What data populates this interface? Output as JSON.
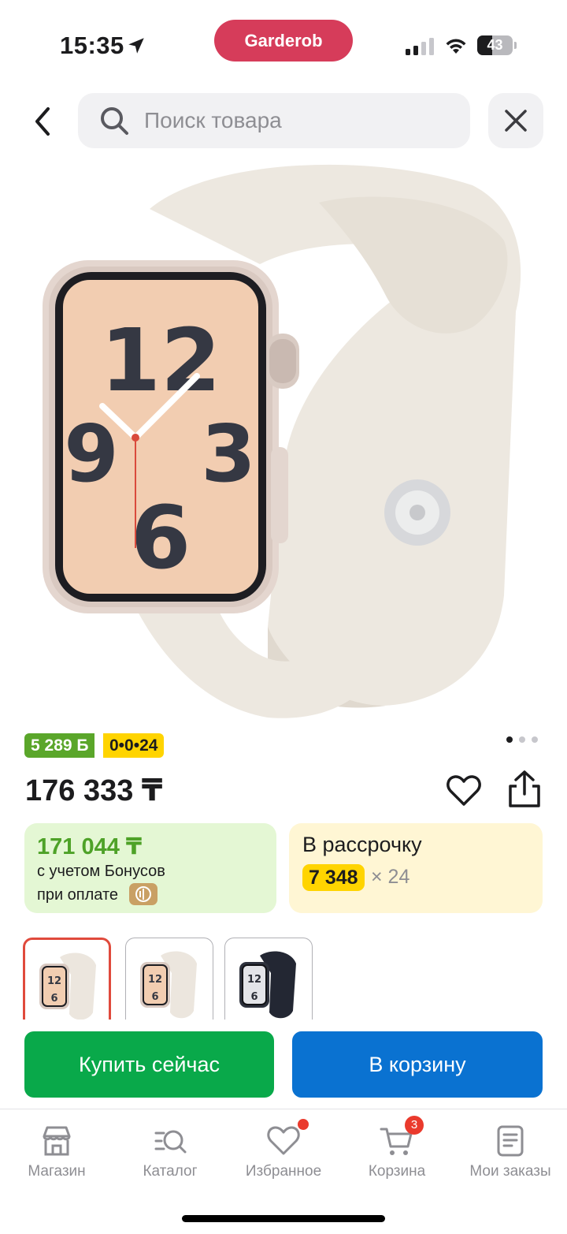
{
  "status_bar": {
    "time": "15:35",
    "app_name": "Garderob",
    "battery": "43",
    "battery_level": 0.43
  },
  "search": {
    "placeholder": "Поиск товара"
  },
  "product": {
    "bonus_badge": "5 289 Б",
    "installment_badge": "0•0•24",
    "price": "176 333 ₸",
    "image_count": 3,
    "active_image": 1
  },
  "bonus_card": {
    "price": "171 044 ₸",
    "line1": "с учетом Бонусов",
    "line2": "при оплате"
  },
  "installment_card": {
    "title": "В рассрочку",
    "amount": "7 348",
    "months": "× 24"
  },
  "thumbnails": [
    {
      "variant": "starlight-gold-face",
      "selected": true
    },
    {
      "variant": "starlight-gold-face",
      "selected": false
    },
    {
      "variant": "midnight",
      "selected": false
    }
  ],
  "actions": {
    "buy_now": "Купить сейчас",
    "add_to_cart": "В корзину"
  },
  "tabs": [
    {
      "label": "Магазин",
      "icon": "store-icon"
    },
    {
      "label": "Каталог",
      "icon": "catalog-search-icon"
    },
    {
      "label": "Избранное",
      "icon": "heart-icon"
    },
    {
      "label": "Корзина",
      "icon": "cart-icon",
      "badge": "3"
    },
    {
      "label": "Мои заказы",
      "icon": "orders-icon"
    }
  ],
  "colors": {
    "brand_pill": "#d63c5a",
    "bonus_green": "#5aa62a",
    "installment_yellow": "#ffd400",
    "buy_green": "#09a94a",
    "cart_blue": "#0a72d1",
    "badge_red": "#ea3a2d"
  }
}
